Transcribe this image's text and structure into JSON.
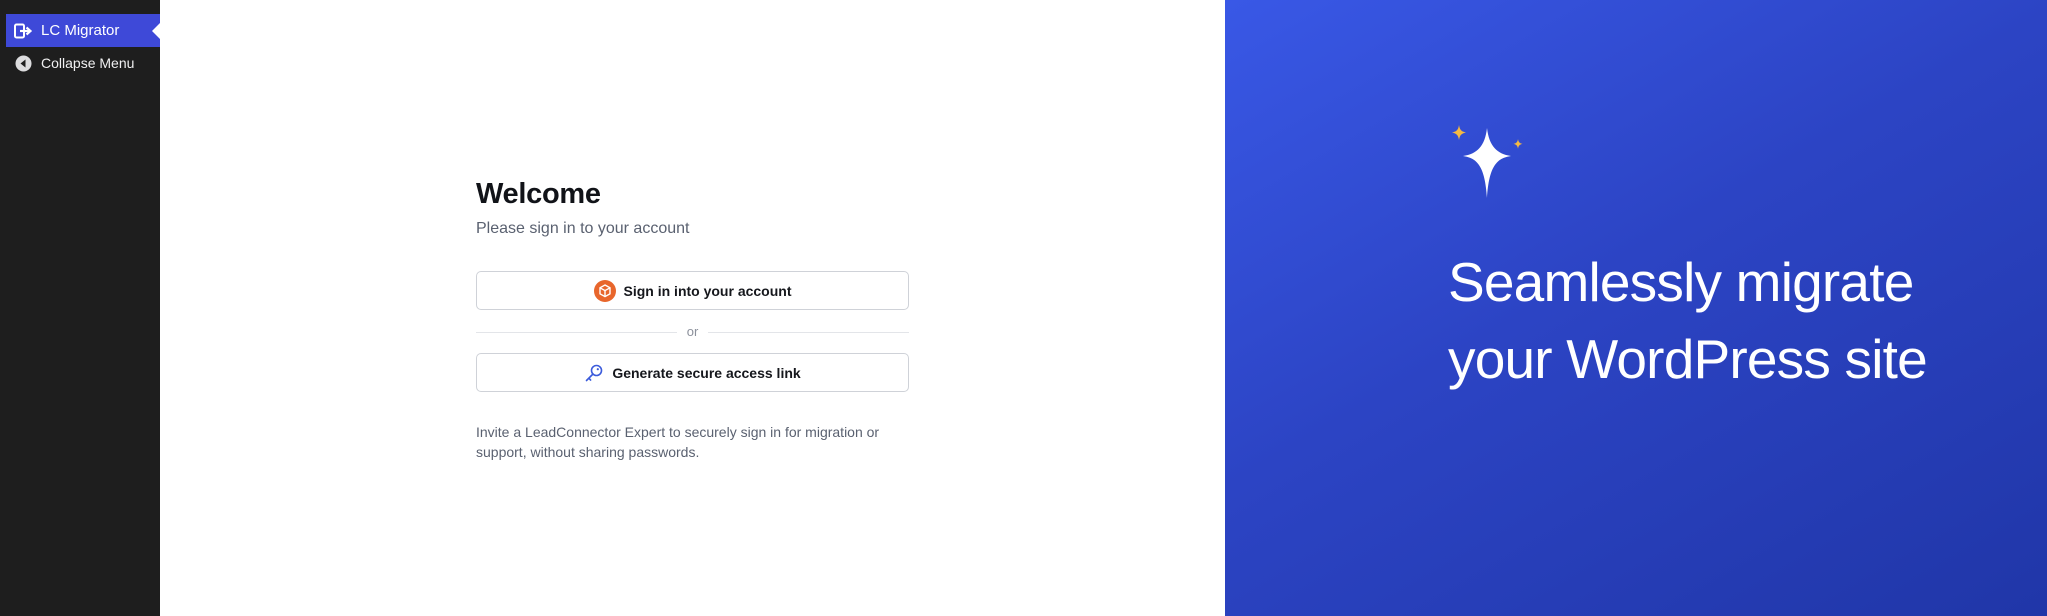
{
  "sidebar": {
    "active_item": {
      "label": "LC Migrator",
      "icon": "exit-arrow-icon"
    },
    "collapse": {
      "label": "Collapse Menu",
      "icon": "collapse-circle-icon"
    }
  },
  "signin": {
    "title": "Welcome",
    "subtitle": "Please sign in to your account",
    "signin_button": "Sign in into your account",
    "divider": "or",
    "access_link_button": "Generate secure access link",
    "hint": "Invite a LeadConnector Expert to securely sign in for migration or support, without sharing passwords."
  },
  "hero": {
    "headline": "Seamlessly migrate your WordPress site",
    "colors": {
      "gradient_start": "#3958e6",
      "gradient_end": "#2036a8",
      "sparkle_accent": "#f5b942"
    }
  },
  "colors": {
    "sidebar_bg": "#1e1e1e",
    "sidebar_active": "#3e49d8",
    "brand_icon": "#e8662c",
    "key_icon": "#3b5bdb"
  }
}
